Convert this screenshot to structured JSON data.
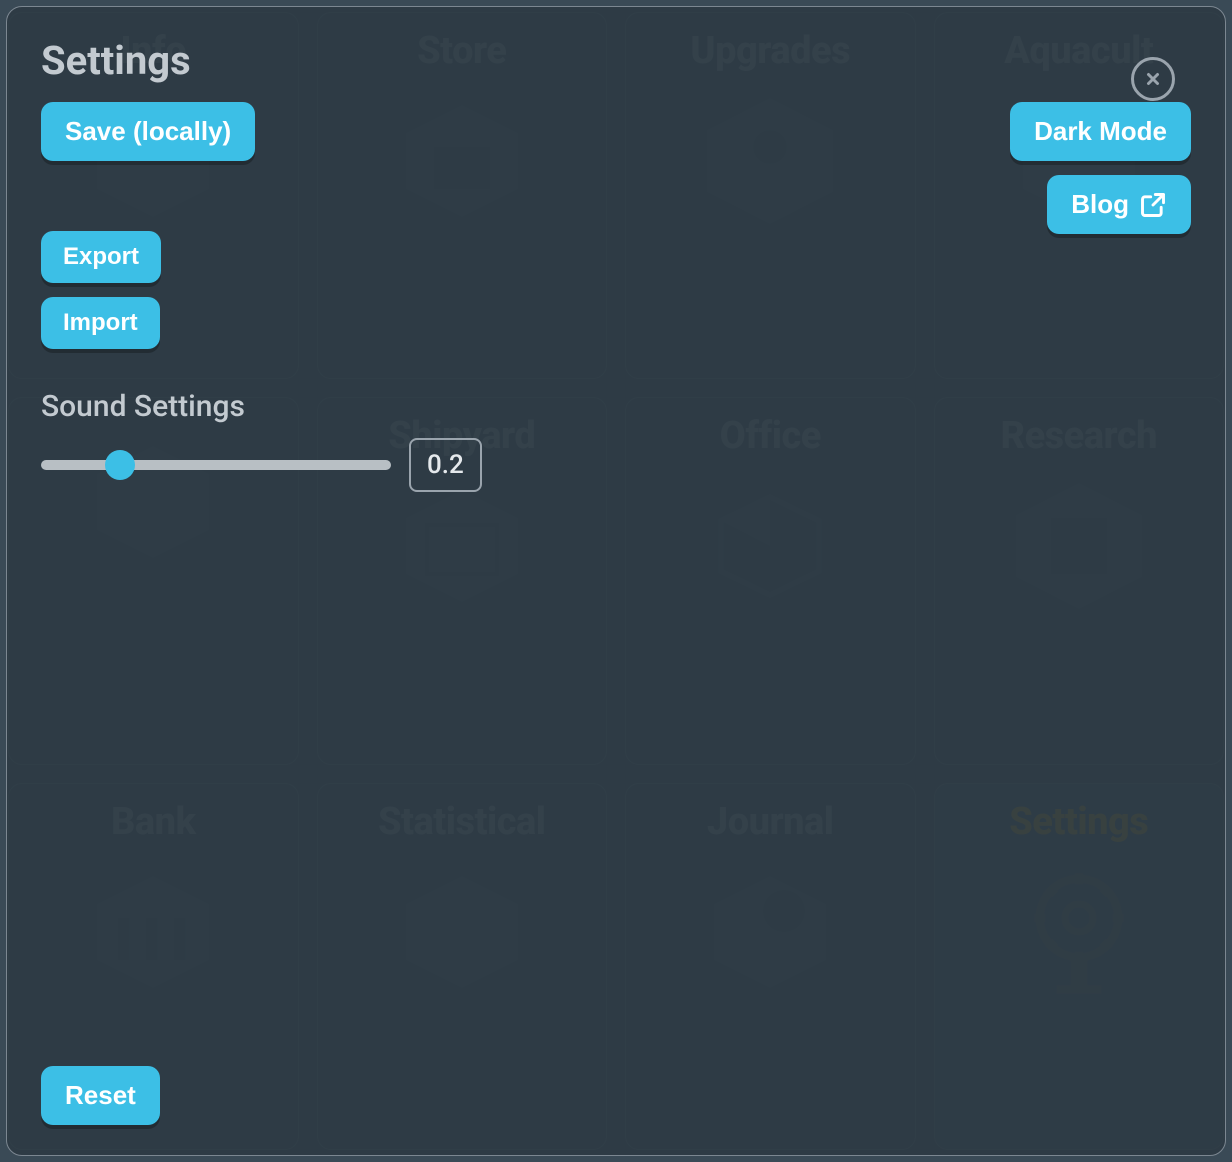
{
  "grid": {
    "cards": [
      {
        "title": "Info"
      },
      {
        "title": "Store"
      },
      {
        "title": "Upgrades"
      },
      {
        "title": "Aquacult"
      },
      {
        "title": ""
      },
      {
        "title": "Shipyard"
      },
      {
        "title": "Office"
      },
      {
        "title": "Research"
      },
      {
        "title": "Bank"
      },
      {
        "title": "Statistical"
      },
      {
        "title": "Journal"
      },
      {
        "title": "Settings",
        "highlight": true
      }
    ]
  },
  "modal": {
    "title": "Settings",
    "save_label": "Save (locally)",
    "export_label": "Export",
    "import_label": "Import",
    "dark_mode_label": "Dark Mode",
    "blog_label": "Blog",
    "sound_label": "Sound Settings",
    "volume_value": "0.2",
    "reset_label": "Reset"
  },
  "colors": {
    "accent": "#3cbfe6",
    "bg": "#3a4a56"
  }
}
